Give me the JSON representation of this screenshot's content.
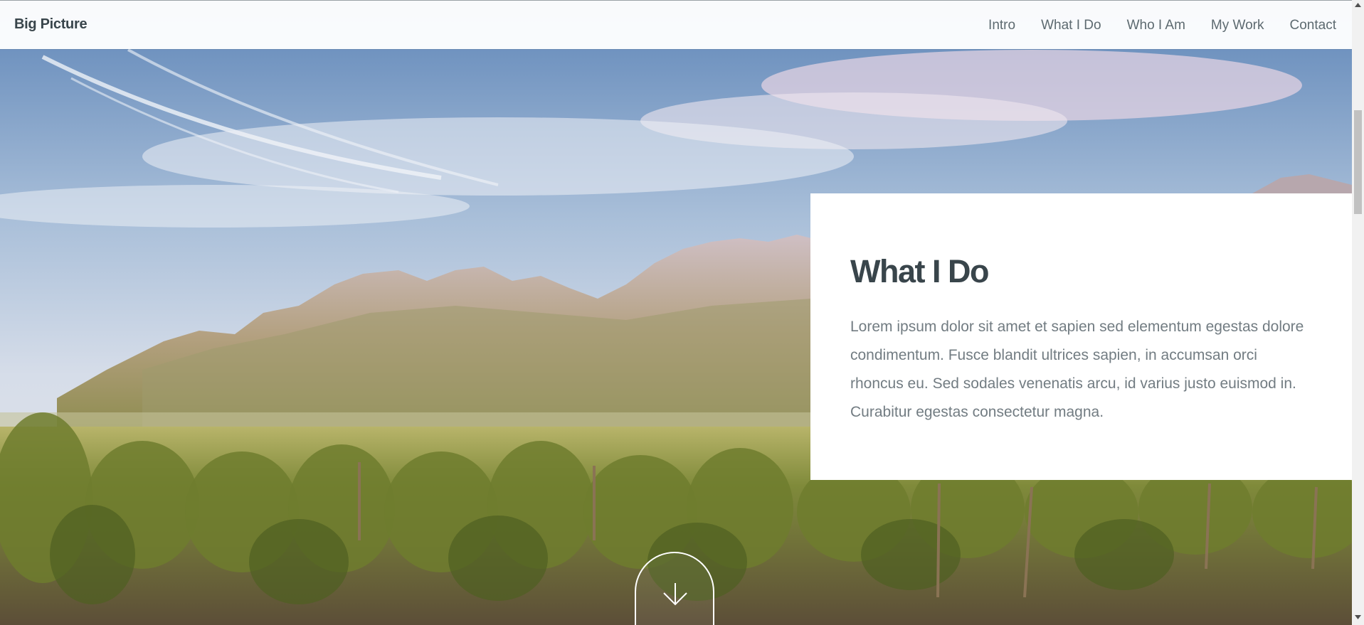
{
  "header": {
    "brand": "Big Picture",
    "nav": [
      {
        "label": "Intro"
      },
      {
        "label": "What I Do"
      },
      {
        "label": "Who I Am"
      },
      {
        "label": "My Work"
      },
      {
        "label": "Contact"
      }
    ]
  },
  "section": {
    "title": "What I Do",
    "body": "Lorem ipsum dolor sit amet et sapien sed elementum egestas dolore condimentum. Fusce blandit ultrices sapien, in accumsan orci rhoncus eu. Sed sodales venenatis arcu, id varius justo euismod in. Curabitur egestas consectetur magna."
  },
  "scroll_button": {
    "icon": "arrow-down-icon"
  },
  "colors": {
    "heading": "#39454b",
    "body_text": "#727c82",
    "nav_text": "#5d6a70",
    "panel_bg": "#ffffff"
  }
}
